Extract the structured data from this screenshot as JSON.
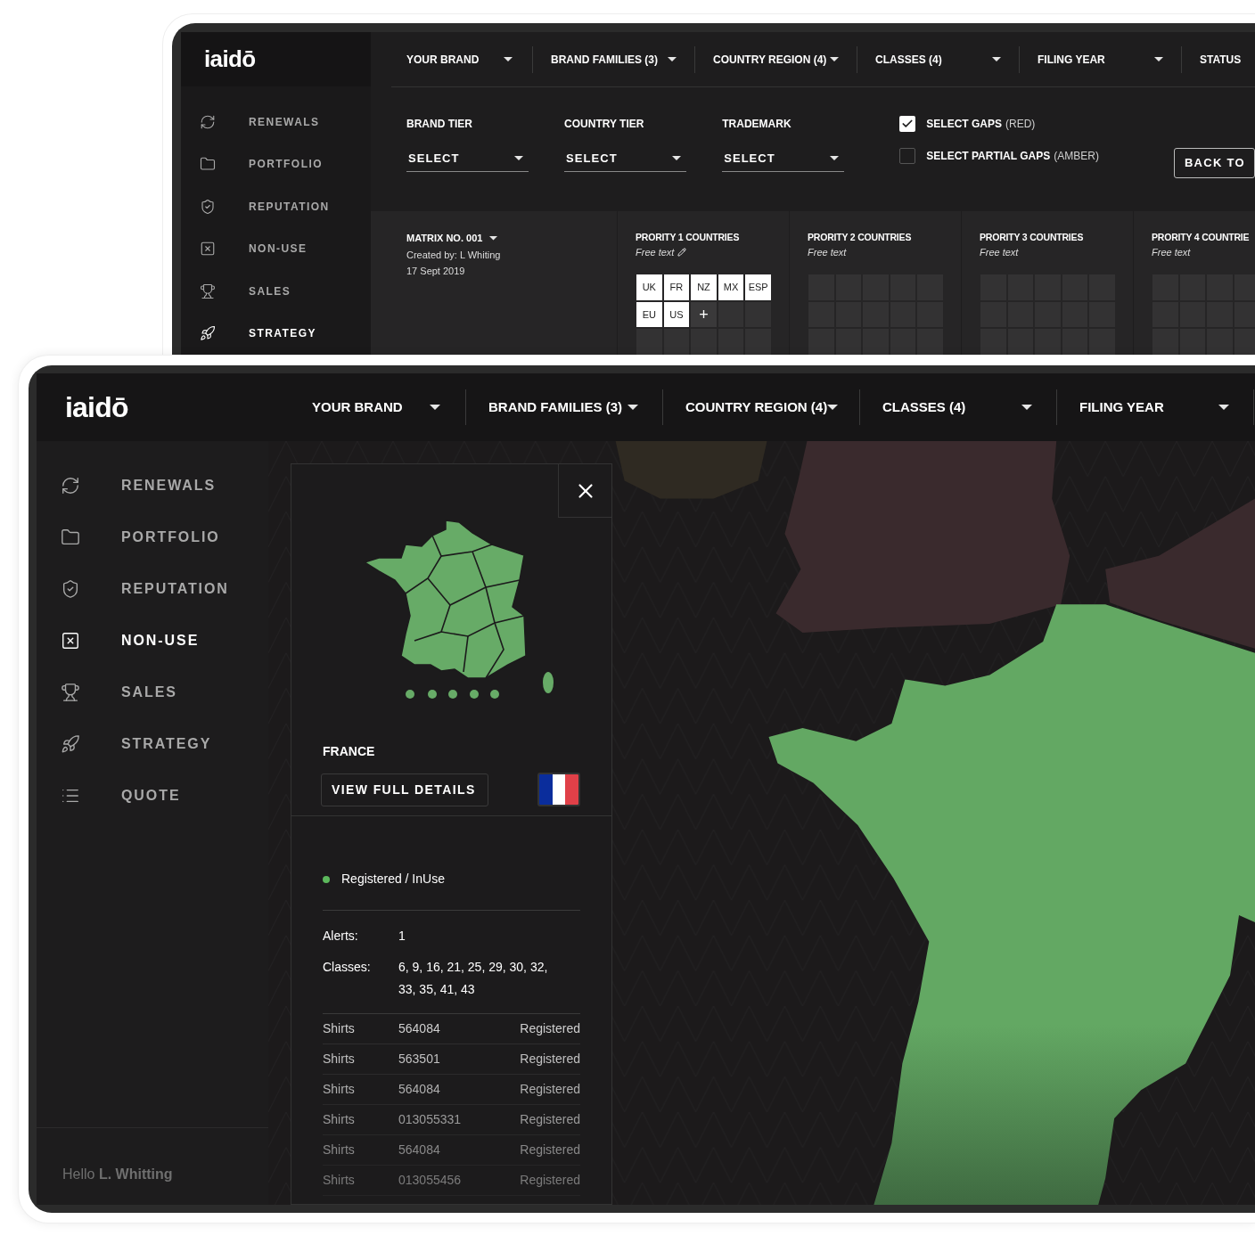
{
  "back_screen": {
    "logo": "iaidō",
    "sidebar": {
      "items": [
        {
          "label": "RENEWALS",
          "selected": false
        },
        {
          "label": "PORTFOLIO",
          "selected": false
        },
        {
          "label": "REPUTATION",
          "selected": false
        },
        {
          "label": "NON-USE",
          "selected": false
        },
        {
          "label": "SALES",
          "selected": false
        },
        {
          "label": "STRATEGY",
          "selected": true
        }
      ]
    },
    "filters": [
      {
        "label": "YOUR BRAND",
        "dropdown": true
      },
      {
        "label": "BRAND FAMILIES (3)",
        "dropdown": true
      },
      {
        "label": "COUNTRY REGION (4)",
        "dropdown": true
      },
      {
        "label": "CLASSES (4)",
        "dropdown": true
      },
      {
        "label": "FILING YEAR",
        "dropdown": true
      },
      {
        "label": "STATUS"
      }
    ],
    "selects": [
      {
        "label": "BRAND TIER",
        "value": "SELECT"
      },
      {
        "label": "COUNTRY TIER",
        "value": "SELECT"
      },
      {
        "label": "TRADEMARK",
        "value": "SELECT"
      }
    ],
    "checkboxes": [
      {
        "label": "SELECT GAPS",
        "note": "(RED)",
        "checked": true
      },
      {
        "label": "SELECT PARTIAL GAPS",
        "note": "(AMBER)",
        "checked": false
      }
    ],
    "back_button": "BACK TO",
    "matrix": {
      "title": "MATRIX NO. 001",
      "created": "Created by: L Whiting",
      "date": "17 Sept 2019"
    },
    "priorities": [
      {
        "title": "PRORITY 1 COUNTRIES",
        "note": "Free text",
        "editable": true,
        "cells": [
          {
            "text": "UK",
            "kind": "country"
          },
          {
            "text": "FR",
            "kind": "country"
          },
          {
            "text": "NZ",
            "kind": "country"
          },
          {
            "text": "MX",
            "kind": "country"
          },
          {
            "text": "ESP",
            "kind": "country"
          },
          {
            "text": "EU",
            "kind": "country"
          },
          {
            "text": "US",
            "kind": "country"
          },
          {
            "text": "+",
            "kind": "add"
          }
        ]
      },
      {
        "title": "PRORITY 2 COUNTRIES",
        "note": "Free text",
        "editable": false
      },
      {
        "title": "PRORITY 3 COUNTRIES",
        "note": "Free text",
        "editable": false
      },
      {
        "title": "PRORITY 4 COUNTRIE",
        "note": "Free text",
        "editable": false
      }
    ]
  },
  "front_screen": {
    "logo": "iaidō",
    "filters": [
      {
        "label": "YOUR BRAND",
        "dropdown": true
      },
      {
        "label": "BRAND FAMILIES (3)",
        "dropdown": true
      },
      {
        "label": "COUNTRY REGION (4)",
        "dropdown": true
      },
      {
        "label": "CLASSES (4)",
        "dropdown": true
      },
      {
        "label": "FILING YEAR",
        "dropdown": true
      }
    ],
    "sidebar": {
      "items": [
        {
          "label": "RENEWALS",
          "selected": false
        },
        {
          "label": "PORTFOLIO",
          "selected": false
        },
        {
          "label": "REPUTATION",
          "selected": false
        },
        {
          "label": "NON-USE",
          "selected": true
        },
        {
          "label": "SALES",
          "selected": false
        },
        {
          "label": "STRATEGY",
          "selected": false
        },
        {
          "label": "QUOTE",
          "selected": false
        }
      ],
      "greeting": "Hello **L. Whitting**"
    },
    "popup": {
      "country": "FRANCE",
      "button": "VIEW FULL DETAILS",
      "status": {
        "text": "Registered / InUse",
        "color": "#5cb85c"
      },
      "details": [
        {
          "label": "Alerts:",
          "value": "1"
        },
        {
          "label": "Classes:",
          "value": "6, 9, 16, 21, 25, 29, 30, 32, 33, 35, 41, 43"
        }
      ],
      "rows": [
        {
          "item": "Shirts",
          "number": "564084",
          "status": "Registered"
        },
        {
          "item": "Shirts",
          "number": "563501",
          "status": "Registered"
        },
        {
          "item": "Shirts",
          "number": "564084",
          "status": "Registered"
        },
        {
          "item": "Shirts",
          "number": "013055331",
          "status": "Registered"
        },
        {
          "item": "Shirts",
          "number": "564084",
          "status": "Registered"
        },
        {
          "item": "Shirts",
          "number": "013055456",
          "status": "Registered"
        }
      ]
    }
  }
}
